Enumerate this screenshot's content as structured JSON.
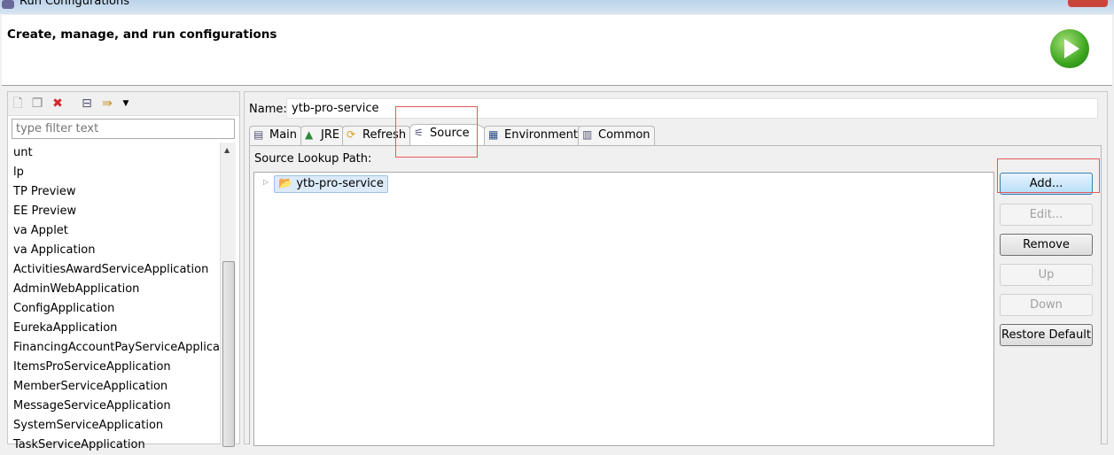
{
  "window": {
    "title": "Run Configurations"
  },
  "header": {
    "title": "Create, manage, and run configurations",
    "run_icon": "run-icon"
  },
  "left": {
    "toolbar": [
      "new-config-icon",
      "duplicate-icon",
      "delete-icon",
      "collapse-all-icon",
      "filter-icon",
      "dropdown-icon"
    ],
    "filter_placeholder": "type filter text",
    "items": [
      "unt",
      "lp",
      "TP Preview",
      "EE Preview",
      "va Applet",
      "va Application",
      "ActivitiesAwardServiceApplication",
      "AdminWebApplication",
      "ConfigApplication",
      "EurekaApplication",
      "FinancingAccountPayServiceApplication",
      "ItemsProServiceApplication",
      "MemberServiceApplication",
      "MessageServiceApplication",
      "SystemServiceApplication",
      "TaskServiceApplication"
    ]
  },
  "right": {
    "name_label": "Name:",
    "name_value": "ytb-pro-service",
    "tabs": [
      {
        "label": "Main",
        "icon": "main-tab-icon"
      },
      {
        "label": "JRE",
        "icon": "jre-icon"
      },
      {
        "label": "Refresh",
        "icon": "refresh-icon"
      },
      {
        "label": "Source",
        "icon": "source-icon",
        "selected": true
      },
      {
        "label": "Environment",
        "icon": "environment-icon"
      },
      {
        "label": "Common",
        "icon": "common-icon"
      }
    ],
    "source_label": "Source Lookup Path:",
    "tree_item": "ytb-pro-service",
    "buttons": [
      {
        "label": "Add...",
        "enabled": true
      },
      {
        "label": "Edit...",
        "enabled": false
      },
      {
        "label": "Remove",
        "enabled": true
      },
      {
        "label": "Up",
        "enabled": false
      },
      {
        "label": "Down",
        "enabled": false
      },
      {
        "label": "Restore Default",
        "enabled": true
      }
    ]
  },
  "colors": {
    "annotation": "#e35a5a",
    "selection": "#dceaf9"
  }
}
